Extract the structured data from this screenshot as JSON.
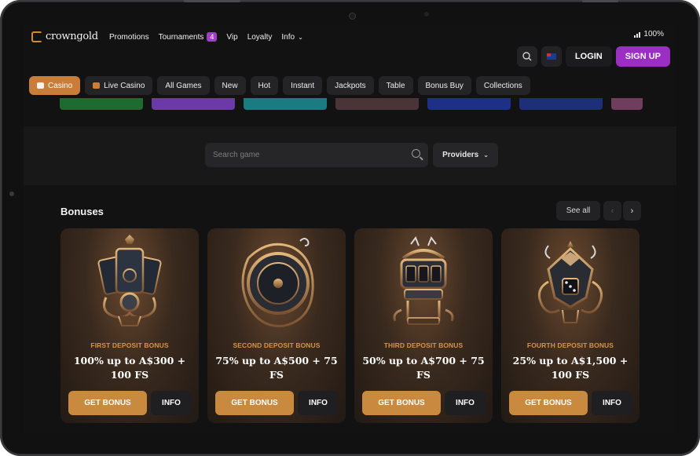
{
  "status": {
    "battery": "100%"
  },
  "brand": {
    "name": "crowngold",
    "accent": "#c97d3a",
    "signup_color": "#9b2fc4"
  },
  "nav": {
    "promotions": "Promotions",
    "tournaments": "Tournaments",
    "tournaments_badge": "4",
    "vip": "Vip",
    "loyalty": "Loyalty",
    "info": "Info",
    "login": "LOGIN",
    "signup": "SIGN UP"
  },
  "tabs": [
    "Casino",
    "Live Casino",
    "All Games",
    "New",
    "Hot",
    "Instant",
    "Jackpots",
    "Table",
    "Bonus Buy",
    "Collections"
  ],
  "search": {
    "placeholder": "Search game",
    "providers": "Providers"
  },
  "bonuses": {
    "title": "Bonuses",
    "see_all": "See all",
    "cards": [
      {
        "label": "FIRST DEPOSIT BONUS",
        "text": "100% up to A$300 + 100 FS",
        "cta": "GET BONUS",
        "info": "INFO"
      },
      {
        "label": "SECOND DEPOSIT BONUS",
        "text": "75% up to A$500 + 75 FS",
        "cta": "GET BONUS",
        "info": "INFO"
      },
      {
        "label": "THIRD DEPOSIT BONUS",
        "text": "50% up to A$700 + 75 FS",
        "cta": "GET BONUS",
        "info": "INFO"
      },
      {
        "label": "FOURTH DEPOSIT BONUS",
        "text": "25% up to A$1,500 + 100 FS",
        "cta": "GET BONUS",
        "info": "INFO"
      }
    ]
  }
}
